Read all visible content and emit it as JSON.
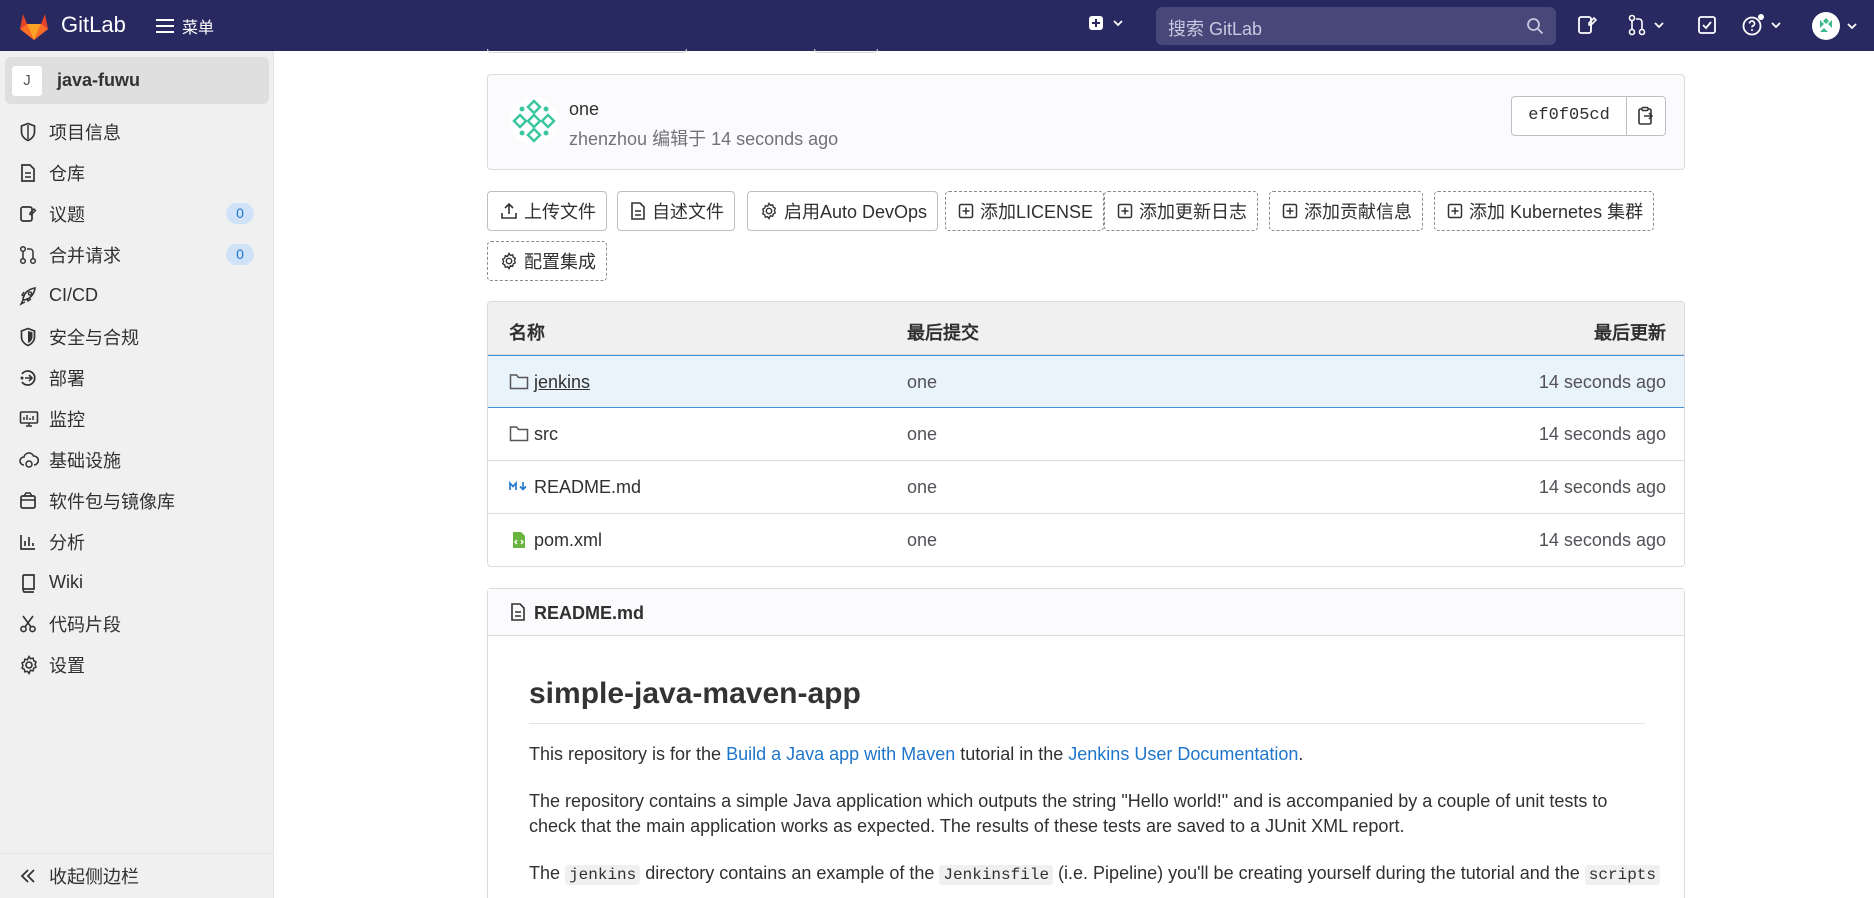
{
  "topbar": {
    "brand": "GitLab",
    "menu_label": "菜单",
    "search_placeholder": "搜索 GitLab"
  },
  "sidebar": {
    "project_initial": "J",
    "project_name": "java-fuwu",
    "items": [
      {
        "label": "项目信息",
        "icon": "info-icon"
      },
      {
        "label": "仓库",
        "icon": "doc-icon"
      },
      {
        "label": "议题",
        "icon": "issues-icon",
        "count": "0"
      },
      {
        "label": "合并请求",
        "icon": "merge-request-icon",
        "count": "0"
      },
      {
        "label": "CI/CD",
        "icon": "rocket-icon"
      },
      {
        "label": "安全与合规",
        "icon": "shield-icon"
      },
      {
        "label": "部署",
        "icon": "deploy-icon"
      },
      {
        "label": "监控",
        "icon": "monitor-icon"
      },
      {
        "label": "基础设施",
        "icon": "cloud-gear-icon"
      },
      {
        "label": "软件包与镜像库",
        "icon": "package-icon"
      },
      {
        "label": "分析",
        "icon": "chart-icon"
      },
      {
        "label": "Wiki",
        "icon": "book-icon"
      },
      {
        "label": "代码片段",
        "icon": "scissors-icon"
      },
      {
        "label": "设置",
        "icon": "gear-icon"
      }
    ],
    "collapse_label": "收起侧边栏"
  },
  "commit": {
    "title": "one",
    "meta": "zhenzhou 编辑于 14 seconds ago",
    "sha": "ef0f05cd"
  },
  "actions": [
    {
      "label": "上传文件",
      "style": "solid",
      "icon": "upload-icon"
    },
    {
      "label": "自述文件",
      "style": "solid",
      "icon": "doc-icon"
    },
    {
      "label": "启用Auto DevOps",
      "style": "solid",
      "icon": "gear-icon"
    },
    {
      "label": "添加LICENSE",
      "style": "dashed",
      "icon": "plus-square-icon"
    },
    {
      "label": "添加更新日志",
      "style": "dashed",
      "icon": "plus-square-icon"
    },
    {
      "label": "添加贡献信息",
      "style": "dashed",
      "icon": "plus-square-icon"
    },
    {
      "label": "添加 Kubernetes 集群",
      "style": "dashed",
      "icon": "plus-square-icon"
    },
    {
      "label": "配置集成",
      "style": "dashed",
      "icon": "gear-icon"
    }
  ],
  "files": {
    "headers": {
      "name": "名称",
      "last_commit": "最后提交",
      "last_update": "最后更新"
    },
    "rows": [
      {
        "name": "jenkins",
        "type": "folder",
        "commit": "one",
        "updated": "14 seconds ago"
      },
      {
        "name": "src",
        "type": "folder",
        "commit": "one",
        "updated": "14 seconds ago"
      },
      {
        "name": "README.md",
        "type": "markdown",
        "commit": "one",
        "updated": "14 seconds ago"
      },
      {
        "name": "pom.xml",
        "type": "xml",
        "commit": "one",
        "updated": "14 seconds ago"
      }
    ]
  },
  "readme": {
    "filename": "README.md",
    "title": "simple-java-maven-app",
    "p1_a": "This repository is for the ",
    "p1_link1": "Build a Java app with Maven",
    "p1_b": " tutorial in the ",
    "p1_link2": "Jenkins User Documentation",
    "p1_c": ".",
    "p2": "The repository contains a simple Java application which outputs the string \"Hello world!\" and is accompanied by a couple of unit tests to check that the main application works as expected. The results of these tests are saved to a JUnit XML report.",
    "p3_a": "The ",
    "p3_code1": "jenkins",
    "p3_b": " directory contains an example of the ",
    "p3_code2": "Jenkinsfile",
    "p3_c": " (i.e. Pipeline) you'll be creating yourself during the tutorial and the ",
    "p3_code3": "scripts"
  }
}
